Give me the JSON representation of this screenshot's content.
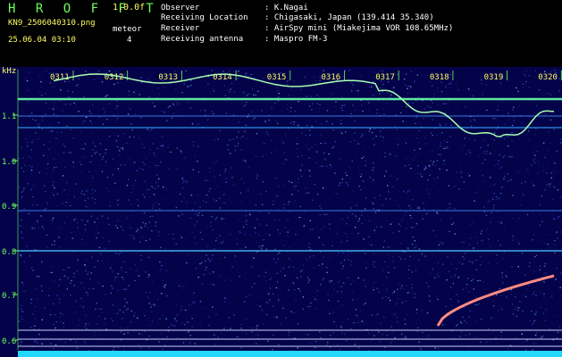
{
  "header": {
    "app_title": "H R O F F T",
    "version": "1.0.0f",
    "file_name": "KN9_2506040310.png",
    "mode_label": "meteor",
    "timestamp": "25.06.04 03:10",
    "mode_value": "4"
  },
  "meta": [
    {
      "key": "Observer",
      "value": ": K.Nagai"
    },
    {
      "key": "Receiving Location",
      "value": ": Chigasaki, Japan (139.414 35.340)"
    },
    {
      "key": "Receiver",
      "value": ": AirSpy mini (Miakejima VOR 108.65MHz)"
    },
    {
      "key": "Receiving antenna",
      "value": ": Maspro FM-3"
    }
  ],
  "spectrogram": {
    "unit": "kHz",
    "y_ticks": [
      "1.1",
      "1.0",
      "0.9",
      "0.8",
      "0.7",
      "0.6"
    ],
    "time_ticks": [
      "0311",
      "0312",
      "0313",
      "0314",
      "0315",
      "0316",
      "0317",
      "0318",
      "0319",
      "0320"
    ],
    "colors": {
      "background": "#04034a",
      "tick_text": "#ffff60",
      "axis_text": "#6cff5a"
    }
  }
}
